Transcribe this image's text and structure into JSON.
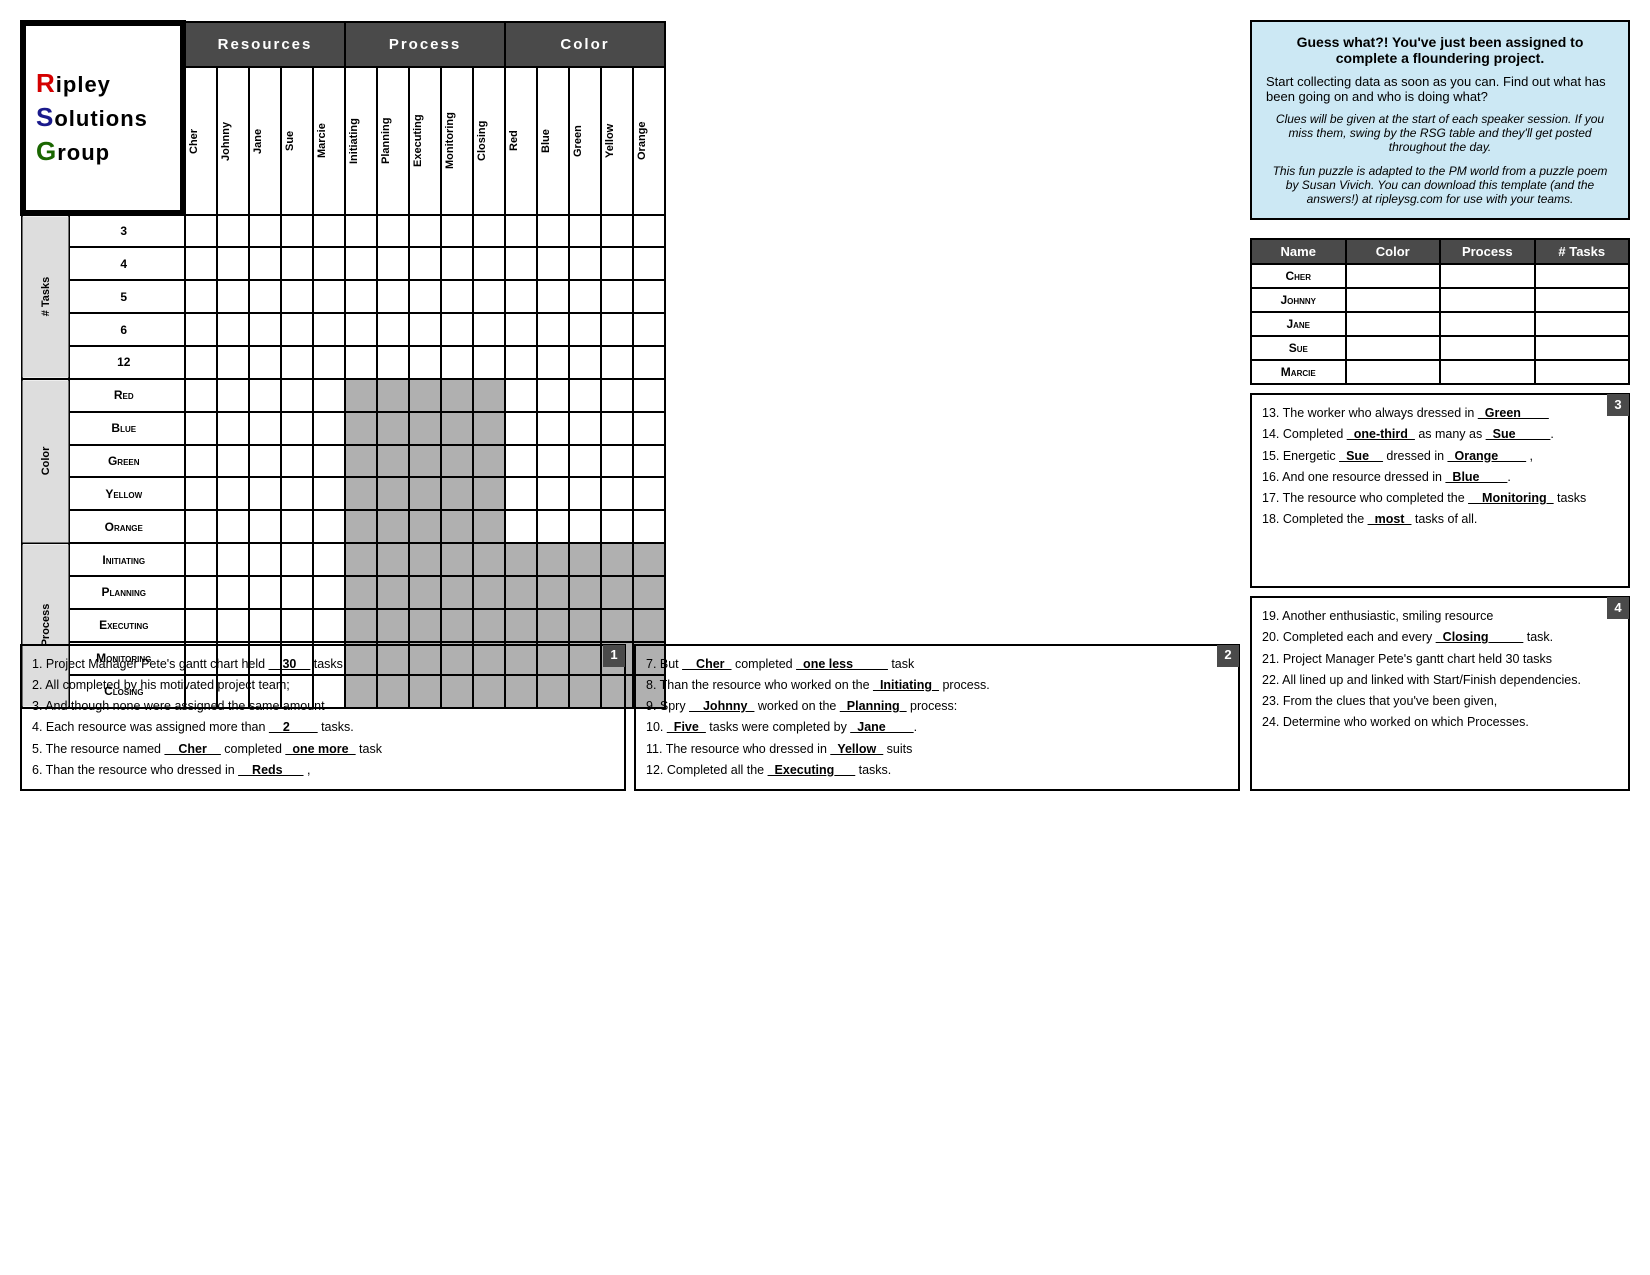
{
  "logo": {
    "line1": "ipley",
    "line2": "olutions",
    "line3": "roup",
    "r": "R",
    "s": "S",
    "g": "G"
  },
  "headers": {
    "resources": "Resources",
    "process": "Process",
    "color": "Color"
  },
  "column_headers": {
    "resources": [
      "Cher",
      "Johnny",
      "Jane",
      "Sue",
      "Marcie"
    ],
    "process": [
      "Initiating",
      "Planning",
      "Executing",
      "Monitoring",
      "Closing"
    ],
    "color": [
      "Red",
      "Blue",
      "Green",
      "Yellow",
      "Orange"
    ]
  },
  "row_groups": {
    "tasks": {
      "label": "# Tasks",
      "rows": [
        "3",
        "4",
        "5",
        "6",
        "12"
      ]
    },
    "color": {
      "label": "Color",
      "rows": [
        "Red",
        "Blue",
        "Green",
        "Yellow",
        "Orange"
      ]
    },
    "process": {
      "label": "Process",
      "rows": [
        "Initiating",
        "Planning",
        "Executing",
        "Monitoring",
        "Closing"
      ]
    }
  },
  "answer_table": {
    "headers": [
      "Name",
      "Color",
      "Process",
      "# Tasks"
    ],
    "rows": [
      {
        "name": "Cher",
        "color": "",
        "process": "",
        "tasks": ""
      },
      {
        "name": "Johnny",
        "color": "",
        "process": "",
        "tasks": ""
      },
      {
        "name": "Jane",
        "color": "",
        "process": "",
        "tasks": ""
      },
      {
        "name": "Sue",
        "color": "",
        "process": "",
        "tasks": ""
      },
      {
        "name": "Marcie",
        "color": "",
        "process": "",
        "tasks": ""
      }
    ]
  },
  "info_panel": {
    "title": "Guess what?! You've just been assigned to complete a floundering project.",
    "body1": "Start collecting data as soon as you can.  Find out what has been going on and who is doing what?",
    "body2": "Clues will be given at the start of each speaker session.  If you miss them, swing by the RSG table and they'll get posted throughout the day.",
    "credit": "This fun puzzle is adapted to the PM world from a puzzle poem by Susan Vivich.  You can download this template (and the answers!) at ripleysg.com for use with your teams."
  },
  "clues": {
    "box1": {
      "number": "1",
      "lines": [
        "1.  Project Manager Pete's gantt chart held __30__ tasks",
        "2.  All completed by his motivated project team;",
        "3.  And though none were assigned the same amount",
        "4.  Each resource was assigned more than __2____ tasks.",
        "5.  The resource named __Cher__ completed _one more_ task",
        "6.  Than the resource who dressed in __Reds___ ,"
      ]
    },
    "box2": {
      "number": "2",
      "lines": [
        "7.  But __Cher_ completed _one less_____ task",
        "8.  Than the resource who worked on the _Initiating_ process.",
        "9.  Spry __Johnny_ worked on the _Planning_ process:",
        "10.  _Five_ tasks were completed by _Jane____.",
        "11.  The resource who dressed in _Yellow_ suits",
        "12.  Completed all the _Executing___ tasks."
      ]
    },
    "box3": {
      "number": "3",
      "lines": [
        "13.  The worker who always dressed in _Green____",
        "14.  Completed _one-third_ as many as _Sue_____.",
        "15.  Energetic _Sue__ dressed in _Orange____ ,",
        "16.  And one resource dressed in _Blue____.",
        "17.  The resource who completed the __Monitoring_ tasks",
        "18.  Completed the _most_ tasks of all."
      ]
    },
    "box4": {
      "number": "4",
      "lines": [
        "19.  Another enthusiastic, smiling resource",
        "20.  Completed each and every _Closing____ task.",
        "21.  Project Manager Pete's gantt chart held 30 tasks",
        "22.  All lined up and linked with Start/Finish dependencies.",
        "23.  From the clues that you've been given,",
        "24.  Determine who worked on which Processes."
      ]
    }
  }
}
